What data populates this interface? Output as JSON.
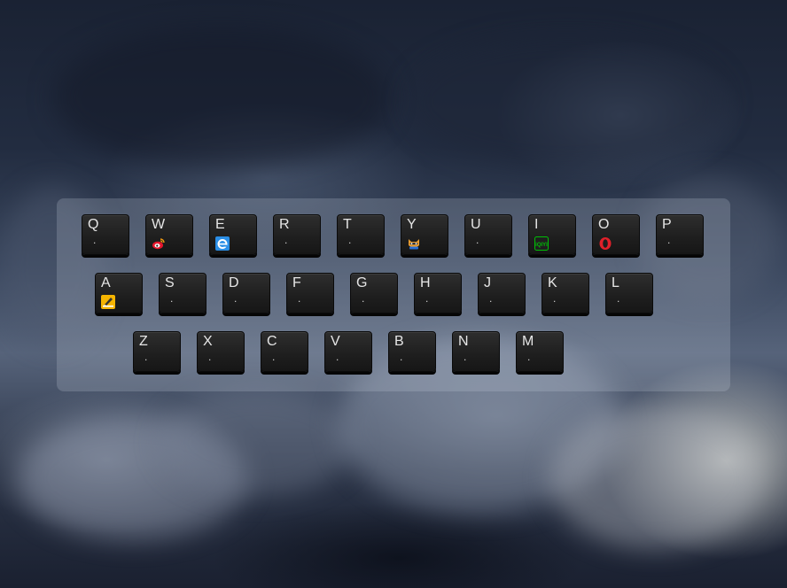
{
  "keyboard": {
    "rows": [
      [
        {
          "letter": "Q",
          "mark": "."
        },
        {
          "letter": "W",
          "icon": "weibo-icon"
        },
        {
          "letter": "E",
          "icon": "ie-browser-icon"
        },
        {
          "letter": "R",
          "mark": "."
        },
        {
          "letter": "T",
          "mark": "."
        },
        {
          "letter": "Y",
          "icon": "raccoon-icon"
        },
        {
          "letter": "U",
          "mark": "."
        },
        {
          "letter": "I",
          "icon": "iqiyi-icon",
          "icon_text": "iQIYI"
        },
        {
          "letter": "O",
          "icon": "opera-icon"
        },
        {
          "letter": "P",
          "mark": "."
        }
      ],
      [
        {
          "letter": "A",
          "icon": "edit-note-icon"
        },
        {
          "letter": "S",
          "mark": "."
        },
        {
          "letter": "D",
          "mark": "."
        },
        {
          "letter": "F",
          "mark": "."
        },
        {
          "letter": "G",
          "mark": "."
        },
        {
          "letter": "H",
          "mark": "."
        },
        {
          "letter": "J",
          "mark": "."
        },
        {
          "letter": "K",
          "mark": "."
        },
        {
          "letter": "L",
          "mark": "."
        }
      ],
      [
        {
          "letter": "Z",
          "mark": "."
        },
        {
          "letter": "X",
          "mark": "."
        },
        {
          "letter": "C",
          "mark": "."
        },
        {
          "letter": "V",
          "mark": "."
        },
        {
          "letter": "B",
          "mark": "."
        },
        {
          "letter": "N",
          "mark": "."
        },
        {
          "letter": "M",
          "mark": "."
        }
      ]
    ]
  },
  "colors": {
    "key_face": "#1e1e1e",
    "key_text": "#e6e6e6",
    "panel": "rgba(200,210,225,0.22)"
  }
}
